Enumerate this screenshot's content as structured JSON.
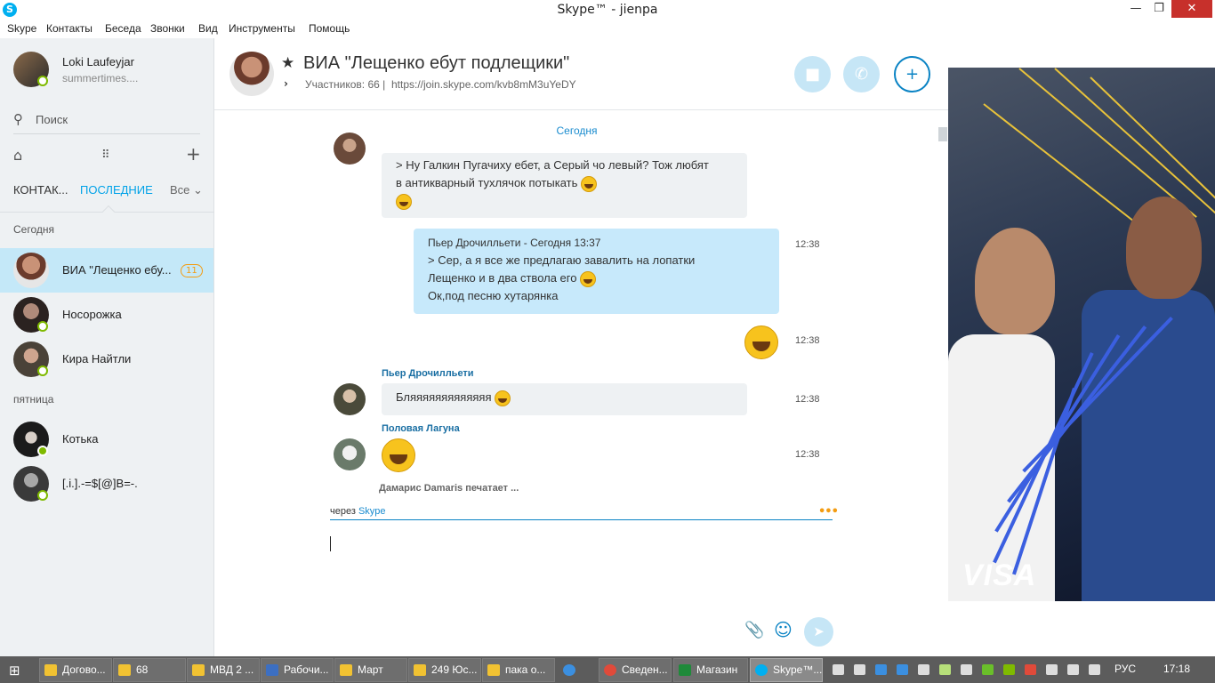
{
  "window": {
    "title": "Skype™ - jienpa",
    "minimize": "—",
    "maximize": "❐",
    "close": "✕",
    "app_icon": "S"
  },
  "menu": [
    "Skype",
    "Контакты",
    "Беседа",
    "Звонки",
    "Вид",
    "Инструменты",
    "Помощь"
  ],
  "profile": {
    "name": "Loki Laufeyjar",
    "mood": "summertimes...."
  },
  "search": {
    "placeholder": "Поиск",
    "icon": "search-icon"
  },
  "sidebar_nav": {
    "home_icon": "⌂",
    "dialpad_icon": "⠿",
    "add_icon": "+"
  },
  "tabs": {
    "contacts": "КОНТАК...",
    "recent": "ПОСЛЕДНИЕ",
    "filter": "Все ⌄"
  },
  "sections": {
    "today": "Сегодня",
    "friday": "пятница"
  },
  "contacts": [
    {
      "name": "ВИА \"Лещенко ебу...",
      "badge": "11",
      "active": true
    },
    {
      "name": "Носорожка"
    },
    {
      "name": "Кира Найтли"
    },
    {
      "name": "Котька"
    },
    {
      "name": "[.i.].-=$[@]B=-."
    }
  ],
  "chat": {
    "title": "ВИА \"Лещенко ебут подлещики\"",
    "star": "★",
    "participants": "Участников: 66",
    "separator": "|",
    "join_link": "https://join.skype.com/kvb8mM3uYeDY",
    "chevron": "›"
  },
  "header_buttons": {
    "video": "■",
    "call": "✆",
    "add_people": "+"
  },
  "messages": {
    "date": "Сегодня",
    "m1": {
      "lines": [
        "> Ну Галкин Пугачиху ебет, а Серый чо левый? Тож любят",
        "в антикварный тухлячок потыкать"
      ]
    },
    "m2": {
      "header": "Пьер Дрочилльети - Сегодня 13:37",
      "lines": [
        "> Сер, а я все же предлагаю завалить на лопатки",
        "Лещенко и в два ствола его",
        "Ок,под песню хутарянка"
      ],
      "time": "12:38"
    },
    "m3": {
      "time": "12:38"
    },
    "m4": {
      "sender": "Пьер Дрочилльети",
      "text": "Бляяяяяяяяяяяяя",
      "time": "12:38"
    },
    "m5": {
      "sender": "Половая Лагуна",
      "time": "12:38"
    }
  },
  "typing": "Дамарис Damaris печатает ...",
  "via": {
    "prefix": "через",
    "link": "Skype"
  },
  "compose": {
    "attach_icon": "📎",
    "emoji_icon": "☺",
    "send_icon": "➤"
  },
  "ad": {
    "brand": "VISA"
  },
  "taskbar": {
    "start_icon": "⊞",
    "tasks": [
      "Догово...",
      "68",
      "МВД 2 ...",
      "Рабочи...",
      "Март",
      "249 Юс...",
      "пака о...",
      "",
      "Сведен...",
      "Магазин",
      "Skype™..."
    ],
    "lang": "РУС",
    "time": "17:18"
  },
  "colors": {
    "accent": "#00a2e8",
    "active_contact": "#c4e8f8",
    "outgoing_bubble": "#c7e9fb",
    "close_button": "#c7302b"
  }
}
